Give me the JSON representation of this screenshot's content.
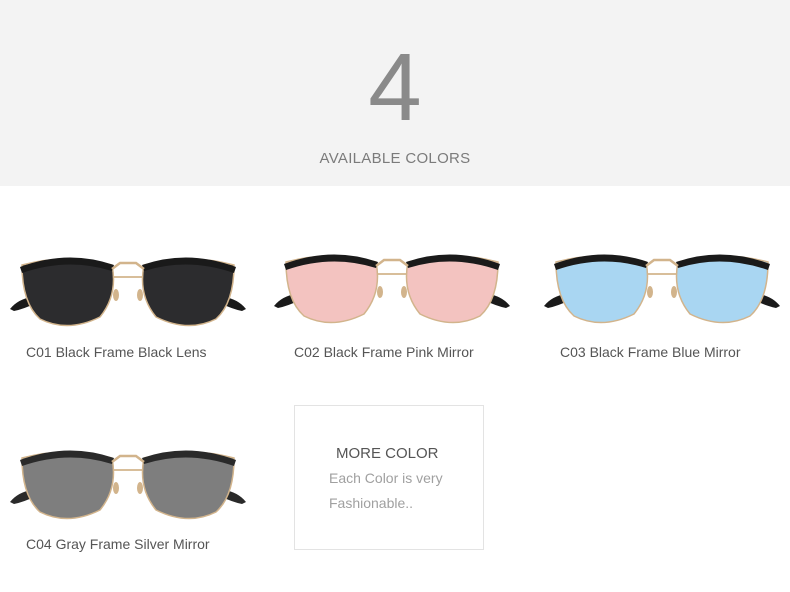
{
  "banner": {
    "number": "4",
    "subtitle": "AVAILABLE COLORS"
  },
  "products": [
    {
      "caption": "C01 Black Frame Black Lens",
      "lens_color": "#2c2c2e",
      "frame_color": "#1a1a1a"
    },
    {
      "caption": "C02 Black Frame Pink Mirror",
      "lens_color": "#f3c3c0",
      "frame_color": "#1a1a1a"
    },
    {
      "caption": "C03 Black Frame Blue Mirror",
      "lens_color": "#a9d6f2",
      "frame_color": "#1a1a1a"
    },
    {
      "caption": "C04 Gray Frame Silver Mirror",
      "lens_color": "#7e7e7e",
      "frame_color": "#2a2a2a"
    }
  ],
  "more": {
    "title": "MORE COLOR",
    "line1": "Each Color is very",
    "line2": "Fashionable.."
  },
  "colors": {
    "banner_bg": "#f3f3f3",
    "metal": "#d2b48c"
  }
}
